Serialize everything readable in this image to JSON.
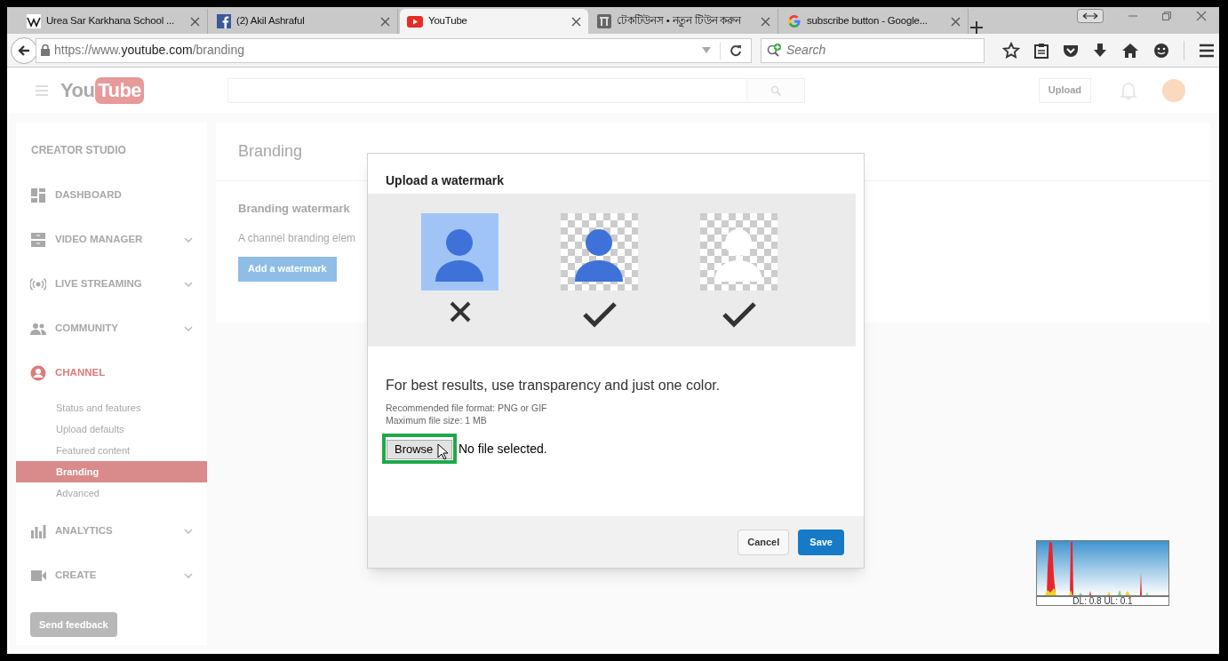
{
  "browser": {
    "tabs": [
      {
        "title": "Urea Sar Karkhana School ...",
        "kind": "wikipedia",
        "selected": false
      },
      {
        "title": "(2) Akil Ashraful",
        "kind": "facebook",
        "selected": false
      },
      {
        "title": "YouTube",
        "kind": "youtube",
        "selected": true
      },
      {
        "title": "টেকটিউনস • নতুন টিউন করুন",
        "kind": "tunes",
        "selected": false
      },
      {
        "title": "subscribe button - Google...",
        "kind": "google",
        "selected": false
      }
    ],
    "url_prefix": "https://www.",
    "url_domain": "youtube.com",
    "url_path": "/branding",
    "search_placeholder": "Search"
  },
  "header": {
    "logo_left": "You",
    "logo_right": "Tube",
    "upload": "Upload"
  },
  "sidebar": {
    "title": "CREATOR STUDIO",
    "items": [
      {
        "label": "DASHBOARD",
        "kind": "dashboard",
        "expandable": false,
        "selected": false
      },
      {
        "label": "VIDEO MANAGER",
        "kind": "videos",
        "expandable": true,
        "selected": false
      },
      {
        "label": "LIVE STREAMING",
        "kind": "live",
        "expandable": true,
        "selected": false
      },
      {
        "label": "COMMUNITY",
        "kind": "community",
        "expandable": true,
        "selected": false
      },
      {
        "label": "CHANNEL",
        "kind": "channel",
        "expandable": false,
        "selected": true,
        "children": [
          {
            "label": "Status and features",
            "selected": false
          },
          {
            "label": "Upload defaults",
            "selected": false
          },
          {
            "label": "Featured content",
            "selected": false
          },
          {
            "label": "Branding",
            "selected": true
          },
          {
            "label": "Advanced",
            "selected": false
          }
        ]
      },
      {
        "label": "ANALYTICS",
        "kind": "analytics",
        "expandable": true,
        "selected": false
      },
      {
        "label": "CREATE",
        "kind": "create",
        "expandable": true,
        "selected": false
      }
    ],
    "feedback": "Send feedback"
  },
  "content": {
    "title": "Branding",
    "section": "Branding watermark",
    "description": "A channel branding elem",
    "button": "Add a watermark"
  },
  "dialog": {
    "title": "Upload a watermark",
    "examples": [
      {
        "kind": "solid",
        "ok": false
      },
      {
        "kind": "transparent-color",
        "ok": true
      },
      {
        "kind": "transparent-white",
        "ok": true
      }
    ],
    "heading": "For best results, use transparency and just one color.",
    "notes": [
      "Recommended file format: PNG or GIF",
      "Maximum file size: 1 MB"
    ],
    "browse": "Browse",
    "file_status": "No file selected.",
    "cancel": "Cancel",
    "save": "Save"
  },
  "net_meter": {
    "label": "DL: 0.8 UL: 0.1"
  }
}
